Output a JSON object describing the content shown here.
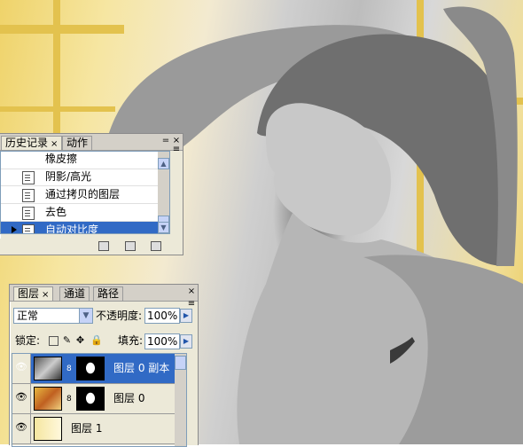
{
  "canvas": {
    "description_icon": "photo-woman-grayscale"
  },
  "history_panel": {
    "tabs": [
      {
        "label": "历史记录"
      },
      {
        "label": "动作"
      }
    ],
    "items": [
      {
        "label": "橡皮擦"
      },
      {
        "label": "阴影/高光"
      },
      {
        "label": "通过拷贝的图层"
      },
      {
        "label": "去色"
      },
      {
        "label": "自动对比度"
      }
    ],
    "selected_index": 4,
    "close_glyph": "×",
    "minimize_glyph": "=",
    "menu_glyph": "≡"
  },
  "layers_panel": {
    "tabs": [
      {
        "label": "图层"
      },
      {
        "label": "通道"
      },
      {
        "label": "路径"
      }
    ],
    "close_glyph": "×",
    "blend_mode": "正常",
    "opacity_label": "不透明度:",
    "opacity_value": "100%",
    "lock_label": "锁定:",
    "fill_label": "填充:",
    "fill_value": "100%",
    "layers": [
      {
        "name": "图层 0 副本",
        "selected": true
      },
      {
        "name": "图层 0",
        "selected": false
      },
      {
        "name": "图层 1",
        "selected": false
      }
    ]
  },
  "colors": {
    "selection": "#316ac5",
    "panel_bg": "#ece9d8"
  }
}
